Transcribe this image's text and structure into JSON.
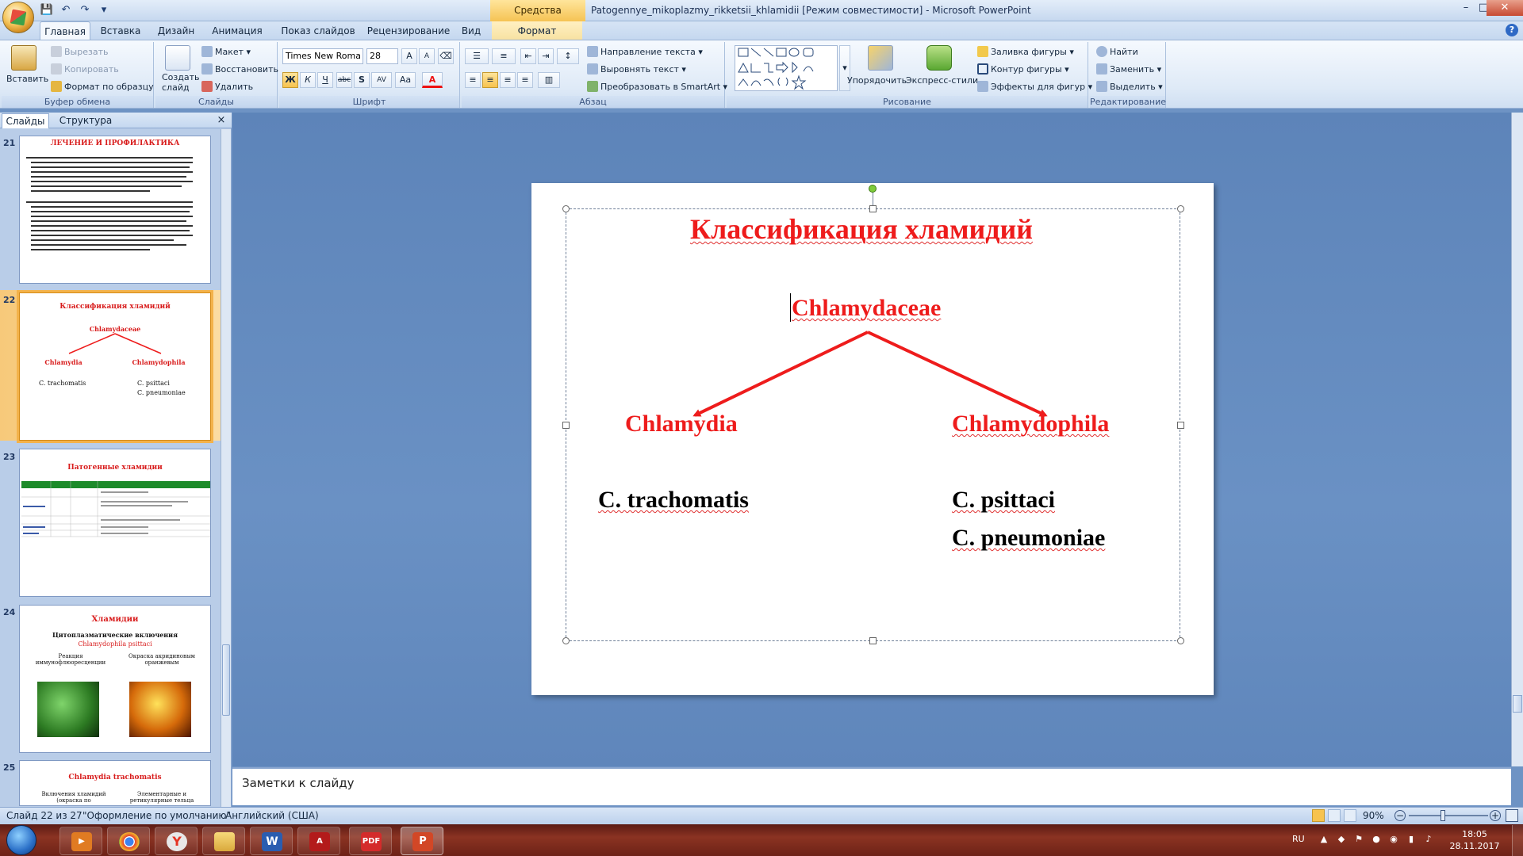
{
  "window": {
    "tool_context": "Средства рисования",
    "title": "Patogennye_mikoplazmy_rikketsii_khlamidii [Режим совместимости] - Microsoft PowerPoint",
    "min": "–",
    "max": "□",
    "close": "✕"
  },
  "ribbon_tabs": [
    "Главная",
    "Вставка",
    "Дизайн",
    "Анимация",
    "Показ слайдов",
    "Рецензирование",
    "Вид",
    "Формат"
  ],
  "ribbon": {
    "clipboard": {
      "label": "Буфер обмена",
      "paste": "Вставить",
      "cut": "Вырезать",
      "copy": "Копировать",
      "format_painter": "Формат по образцу"
    },
    "slides": {
      "label": "Слайды",
      "create": "Создать слайд",
      "layout": "Макет",
      "reset": "Восстановить",
      "delete": "Удалить"
    },
    "font": {
      "label": "Шрифт",
      "font_name": "Times New Roma",
      "font_size": "28",
      "bold": "Ж",
      "italic": "К",
      "underline": "Ч",
      "strike": "abc",
      "shadow": "S",
      "spacing": "AV",
      "case": "Aa",
      "color": "A",
      "grow": "A",
      "shrink": "A"
    },
    "paragraph": {
      "label": "Абзац",
      "direction": "Направление текста",
      "align": "Выровнять текст",
      "smartart": "Преобразовать в SmartArt"
    },
    "drawing": {
      "label": "Рисование",
      "arrange": "Упорядочить",
      "quick_styles": "Экспресс-стили",
      "fill": "Заливка фигуры",
      "outline": "Контур фигуры",
      "effects": "Эффекты для фигур"
    },
    "editing": {
      "label": "Редактирование",
      "find": "Найти",
      "replace": "Заменить",
      "select": "Выделить"
    }
  },
  "left_pane": {
    "tabs": [
      "Слайды",
      "Структура"
    ],
    "close": "×",
    "thumbnails": [
      {
        "num": "21",
        "title": "ЛЕЧЕНИЕ И ПРОФИЛАКТИКА"
      },
      {
        "num": "22",
        "title": "Классификация хламидий",
        "root": "Chlamydaceae",
        "left": "Chlamydia",
        "right": "Chlamydophila",
        "left_sp": "C. trachomatis",
        "right_sp1": "C. psittaci",
        "right_sp2": "C. pneumoniae"
      },
      {
        "num": "23",
        "title": "Патогенные хламидии"
      },
      {
        "num": "24",
        "title": "Хламидии",
        "sub1": "Цитоплазматические включения",
        "sub2": "Chlamydophila psittaci",
        "cap1": "Реакция иммунофлюоресценции",
        "cap2": "Окраска акридиновым оранжевым"
      },
      {
        "num": "25",
        "title": "Chlamydia trachomatis",
        "cap1": "Включения хламидий (окраска по",
        "cap2": "Элементарные и ретикулярные тельца"
      }
    ]
  },
  "slide": {
    "title": "Классификация хламидий",
    "root": "Chlamydaceae",
    "left_genus": "Chlamydia",
    "right_genus": "Chlamydophila",
    "left_species": "C. trachomatis",
    "right_species_1": "C. psittaci",
    "right_species_2": "C. pneumoniae"
  },
  "notes_placeholder": "Заметки к слайду",
  "status": {
    "slide_counter": "Слайд 22 из 27",
    "theme": "\"Оформление по умолчанию\"",
    "language": "Английский (США)",
    "zoom": "90%"
  },
  "taskbar": {
    "lang": "RU",
    "time": "18:05",
    "date": "28.11.2017"
  },
  "colors": {
    "accent_red": "#ee1c1c",
    "ribbon_bg": "#dfeaf7",
    "editor_bg": "#6a91c4"
  }
}
